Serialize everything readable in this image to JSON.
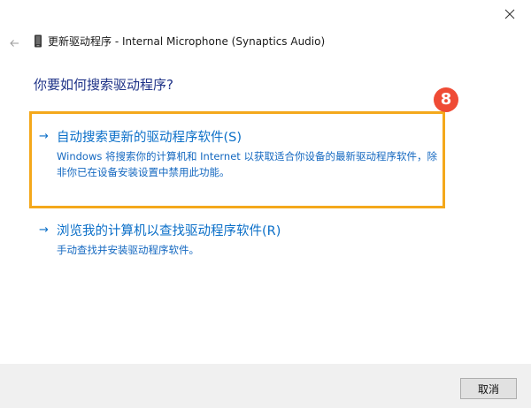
{
  "window": {
    "title": "更新驱动程序 - Internal Microphone (Synaptics Audio)"
  },
  "main": {
    "heading": "你要如何搜索驱动程序?",
    "options": [
      {
        "arrow": "→",
        "title": "自动搜索更新的驱动程序软件(S)",
        "description": "Windows 将搜索你的计算机和 Internet 以获取适合你设备的最新驱动程序软件，除非你已在设备安装设置中禁用此功能。"
      },
      {
        "arrow": "→",
        "title": "浏览我的计算机以查找驱动程序软件(R)",
        "description": "手动查找并安装驱动程序软件。"
      }
    ]
  },
  "annotation": {
    "step_number": "8",
    "highlight_color": "#f4a81b",
    "badge_color": "#ef4b35"
  },
  "footer": {
    "cancel_label": "取消"
  },
  "icons": {
    "close": "close-icon",
    "back": "back-arrow-icon",
    "device": "microphone-device-icon"
  }
}
